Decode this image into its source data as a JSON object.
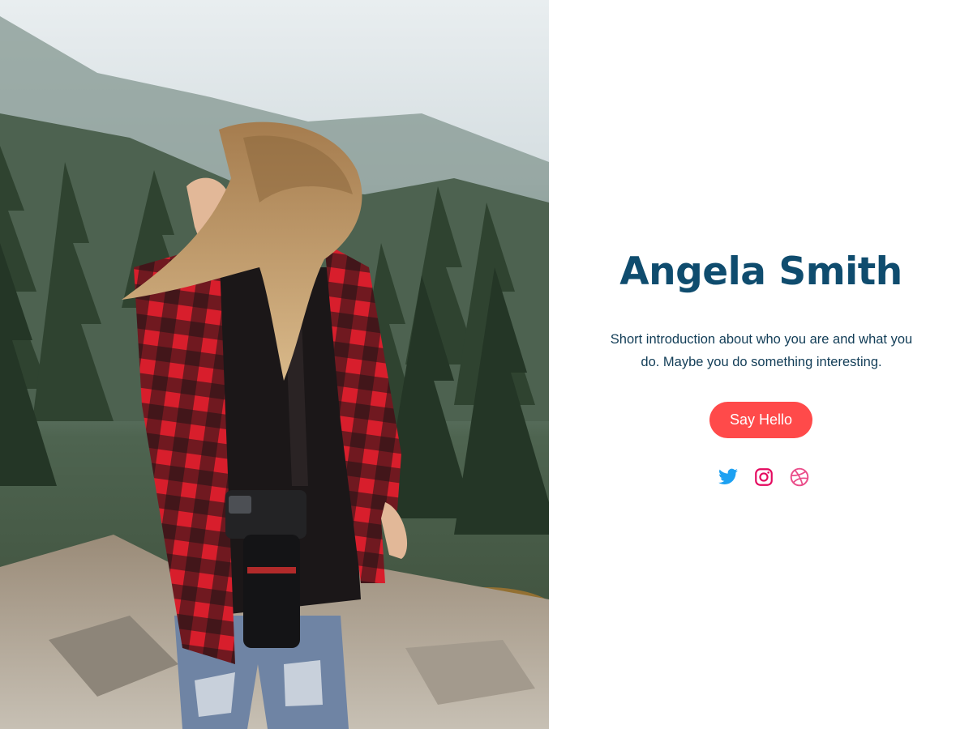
{
  "hero": {
    "photo_icon": "portrait-photo-woman-with-camera",
    "name": "Angela Smith",
    "intro": "Short introduction about who you are and what you do. Maybe you do something interesting.",
    "cta_label": "Say Hello"
  },
  "socials": [
    {
      "icon": "twitter-icon",
      "color": "#1da1f2"
    },
    {
      "icon": "instagram-icon",
      "color": "#e4095f"
    },
    {
      "icon": "dribbble-icon",
      "color": "#ea4c89"
    }
  ],
  "colors": {
    "name": "#0f4c6e",
    "text": "#123d57",
    "accent": "#ff4a4a",
    "background": "#ffffff"
  }
}
